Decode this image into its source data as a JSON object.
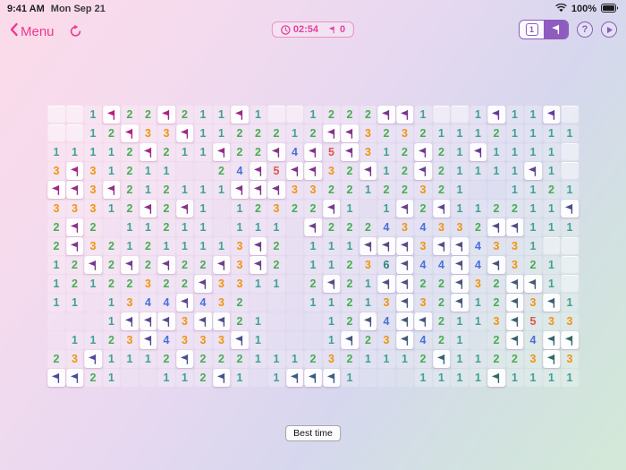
{
  "status_bar": {
    "time": "9:41 AM",
    "date": "Mon Sep 21",
    "battery": "100%"
  },
  "nav": {
    "menu_label": "Menu",
    "timer_value": "02:54",
    "flags_remaining": "0",
    "mode_toggle": {
      "dig_label": "1",
      "flag_segment": "flag-mode"
    },
    "help_label": "?"
  },
  "footer": {
    "best_time_label": "Best time"
  },
  "board": {
    "columns": 29,
    "rows": 15,
    "legend": "U=unrevealed, E=revealed empty, F=flag, digits=adjacent mine counts",
    "grid": [
      "U U 1 F 2 2 F 2 1 1 F 1 U U 1 2 2 2 F F 1 U U 1 F 1 1 F U",
      "U U 1 2 F 3 3 F 1 1 2 2 2 1 2 F F 3 2 3 2 1 1 1 2 1 1 1 1",
      "1 1 1 1 2 F 2 1 1 F 2 2 F 4 F 5 F 3 1 2 F 2 1 F 1 1 1 1 U",
      "3 F 3 1 2 1 1 E E 2 4 F 5 F F 3 2 F 1 2 F 2 1 1 1 1 F 1 U",
      "F F 3 F 2 1 2 1 1 1 F F F 3 3 2 2 1 2 2 3 2 1 E E 1 1 2 1",
      "3 3 3 1 2 F 2 F 1 E 1 2 3 2 2 F 1 E 1 F 2 F 1 1 2 2 1 1 F",
      "2 F 2 E 1 1 2 1 1 E 1 1 1 E F 2 2 2 4 3 4 3 3 2 F F 1 1 1",
      "2 F 3 2 1 2 1 1 1 1 3 F 2 E 1 1 1 F F F 3 F F 4 3 3 1 U U",
      "1 2 F 2 F 2 F 2 2 F 3 F 2 E 1 1 2 3 6 F 4 4 F 4 F 3 2 1 U",
      "1 2 1 2 2 3 2 2 F 3 3 1 1 E 2 F 2 1 F F 2 2 F 3 2 F F 1 U",
      "1 1 E 1 3 4 4 F 4 3 2 E E E 1 1 2 1 3 F 3 2 F 1 2 F 3 F 1",
      "E E E 1 F F F 3 F F 2 1 E E E 1 2 F 4 F F 2 1 1 3 F 5 3 3",
      "E 1 1 2 3 F 4 3 3 3 F 1 E E E 1 F 2 3 F 4 2 1 E 2 F 4 F F",
      "2 3 F 1 1 1 2 F 2 2 2 1 1 1 2 3 2 1 1 1 2 F 1 1 2 2 3 F 3",
      "F F 2 1 E E 1 1 2 F 1 E 1 F F F 1 E E E 1 1 1 1 F 1 1 1 1"
    ],
    "number_colors": {
      "1": "#3fa195",
      "2": "#47ad53",
      "3": "#f0940f",
      "4": "#4a6fd9",
      "5": "#e2544a",
      "6": "#2b8375"
    },
    "flag_color_corners": {
      "tl": "#c31a7d",
      "tr": "#5e3a9e",
      "bl": "#474b9e",
      "br": "#2f6b5e"
    }
  },
  "colors": {
    "accent_pink": "#f0368f",
    "accent_purple": "#8e5bbe"
  }
}
